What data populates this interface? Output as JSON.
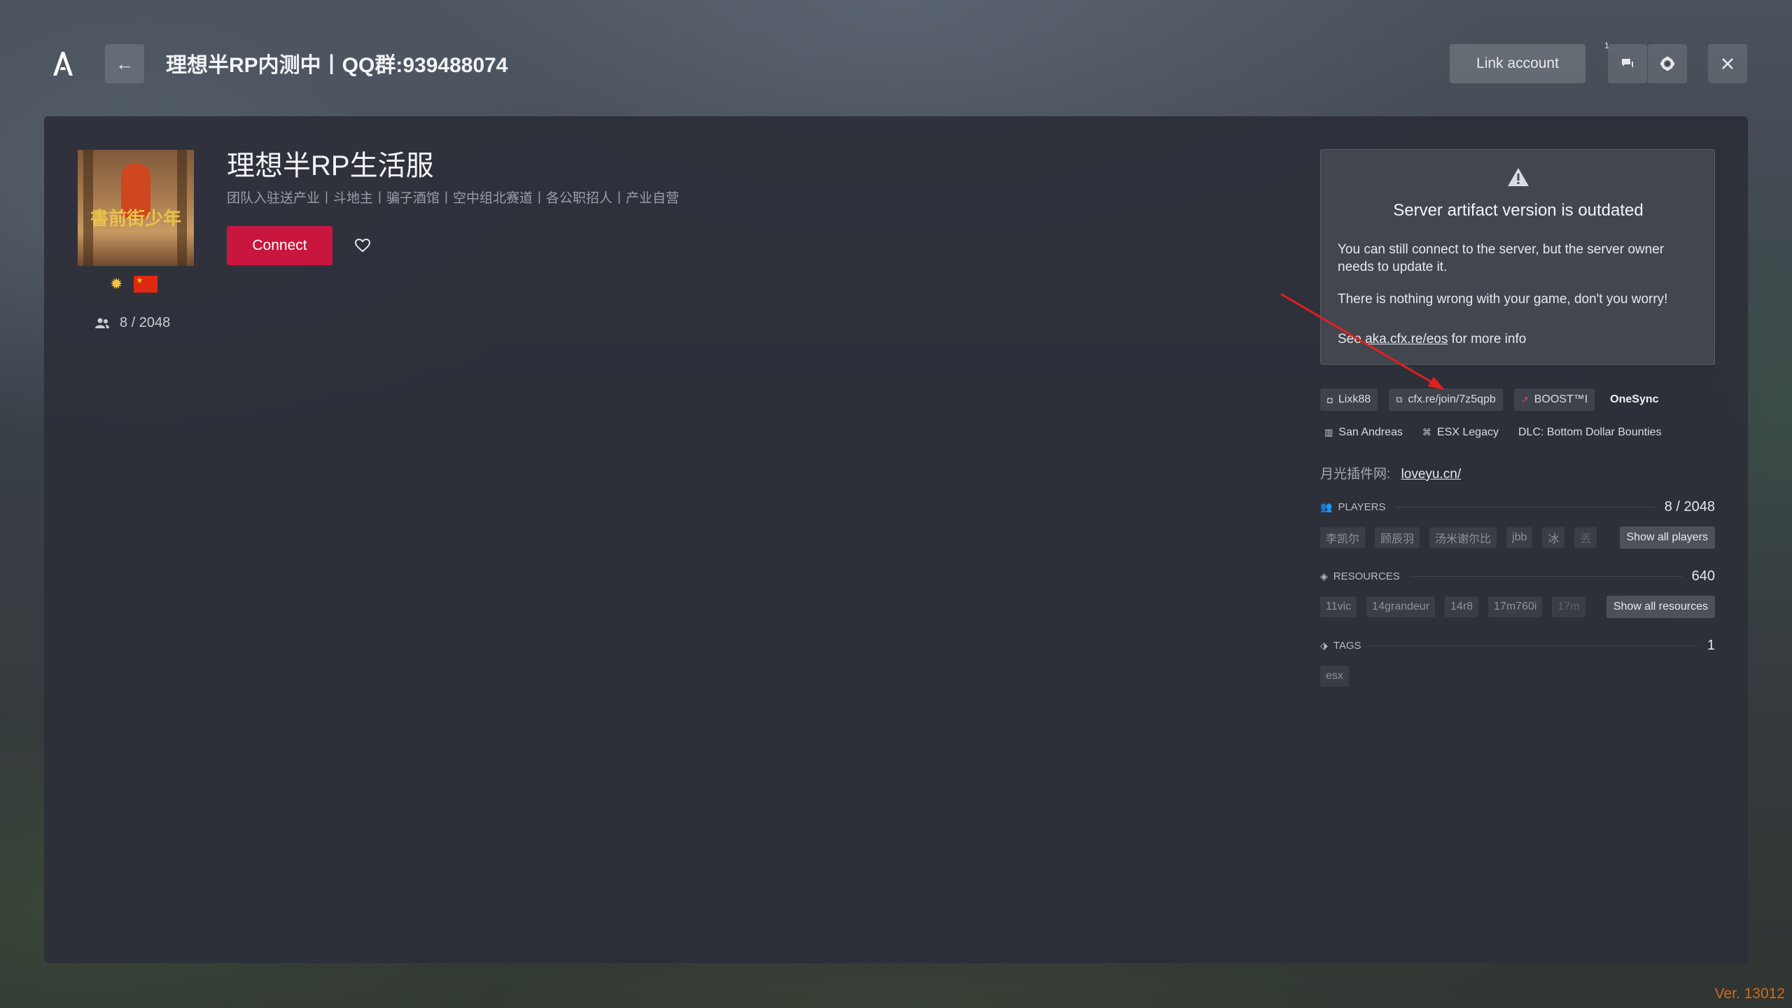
{
  "topbar": {
    "title": "理想半RP内测中丨QQ群:939488074",
    "link_account": "Link account",
    "notification_count": "1"
  },
  "server": {
    "name": "理想半RP生活服",
    "description": "团队入驻送产业丨斗地主丨骗子酒馆丨空中组北赛道丨各公职招人丨产业自营",
    "connect_label": "Connect",
    "players": "8 / 2048"
  },
  "warning": {
    "title": "Server artifact version is outdated",
    "p1": "You can still connect to the server, but the server owner needs to update it.",
    "p2": "There is nothing wrong with your game, don't you worry!",
    "p3_prefix": "See",
    "p3_link": "aka.cfx.re/eos",
    "p3_suffix": "for more info"
  },
  "chips_row1": [
    "Lixk88",
    "cfx.re/join/7z5qpb",
    "BOOST™I",
    "OneSync"
  ],
  "chips_row2": [
    "San Andreas",
    "ESX Legacy",
    "DLC: Bottom Dollar Bounties"
  ],
  "website": {
    "label": "月光插件网:",
    "value": "loveyu.cn/"
  },
  "players_section": {
    "label": "PLAYERS",
    "count": "8 / 2048",
    "names": [
      "李凯尔",
      "顾辰羽",
      "汤米谢尔比",
      "jbb",
      "冰",
      "丢"
    ],
    "show_all": "Show all players"
  },
  "resources_section": {
    "label": "RESOURCES",
    "count": "640",
    "names": [
      "11vic",
      "14grandeur",
      "14r8",
      "17m760i",
      "17m"
    ],
    "show_all": "Show all resources"
  },
  "tags_section": {
    "label": "TAGS",
    "count": "1",
    "names": [
      "esx"
    ]
  },
  "version": "Ver. 13012",
  "colors": {
    "accent": "#c8163f",
    "version": "#d36a1c",
    "annotation_arrow": "#e02020"
  }
}
